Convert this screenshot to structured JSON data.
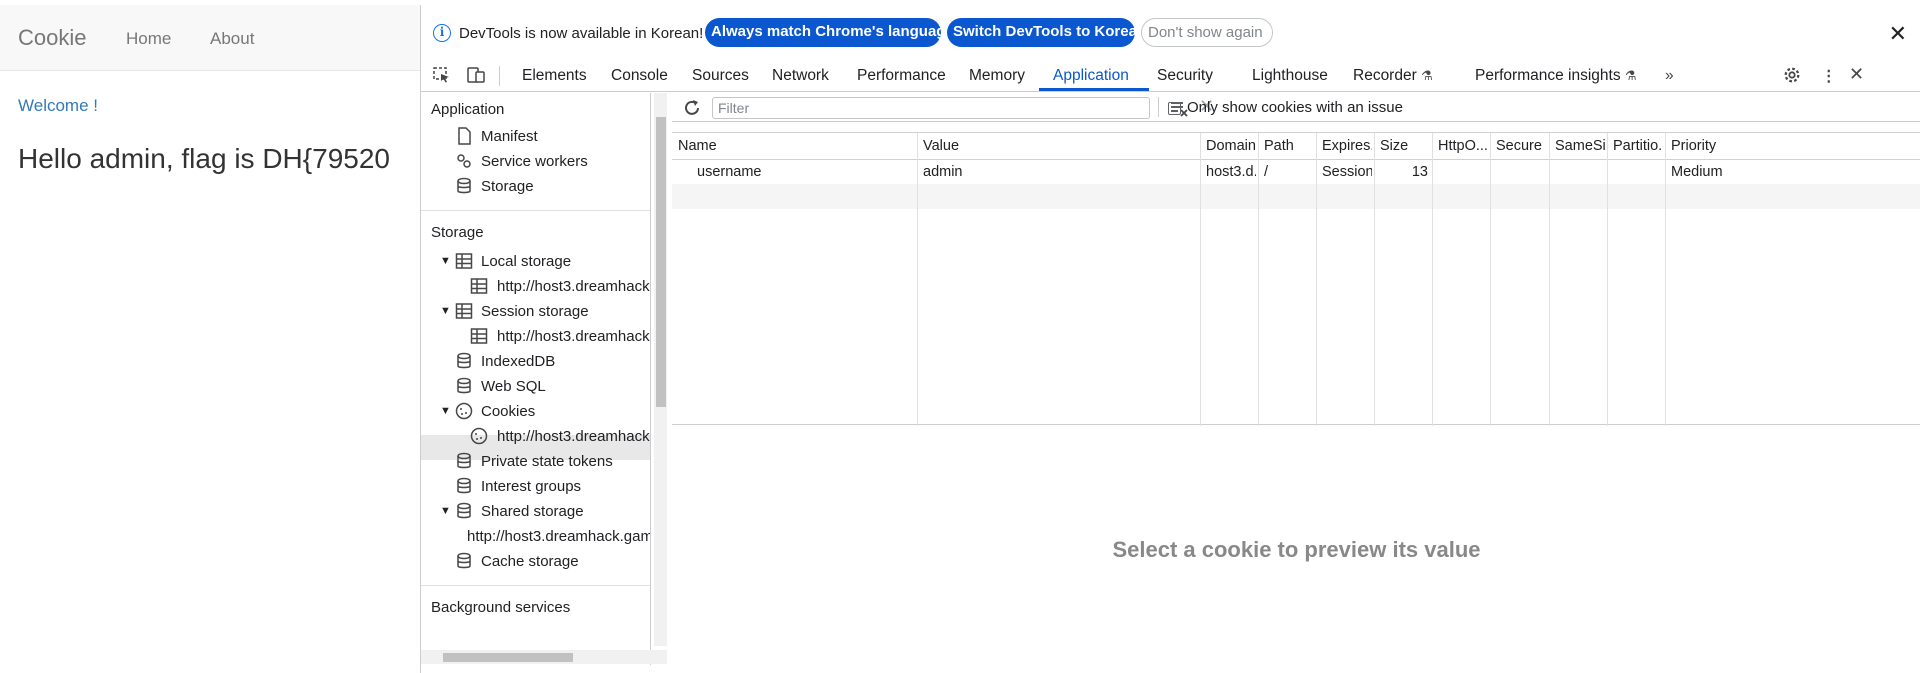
{
  "webpage": {
    "brand": "Cookie",
    "nav": [
      "Home",
      "About"
    ],
    "welcome": "Welcome !",
    "message": "Hello admin, flag is DH{79520"
  },
  "infobar": {
    "text": "DevTools is now available in Korean!",
    "btn_match": "Always match Chrome's language",
    "btn_switch": "Switch DevTools to Korean",
    "btn_dont_show": "Don't show again"
  },
  "tabs": [
    "Elements",
    "Console",
    "Sources",
    "Network",
    "Performance",
    "Memory",
    "Application",
    "Security",
    "Lighthouse",
    "Recorder",
    "Performance insights"
  ],
  "active_tab": "Application",
  "sidebar": {
    "application_heading": "Application",
    "application_items": [
      "Manifest",
      "Service workers",
      "Storage"
    ],
    "storage_heading": "Storage",
    "local_storage": "Local storage",
    "local_storage_child": "http://host3.dreamhack",
    "session_storage": "Session storage",
    "session_storage_child": "http://host3.dreamhack",
    "indexeddb": "IndexedDB",
    "websql": "Web SQL",
    "cookies": "Cookies",
    "cookies_child": "http://host3.dreamhack",
    "private_state_tokens": "Private state tokens",
    "interest_groups": "Interest groups",
    "shared_storage": "Shared storage",
    "shared_storage_child": "http://host3.dreamhack.gam",
    "cache_storage": "Cache storage",
    "background_heading": "Background services"
  },
  "toolbar": {
    "filter_placeholder": "Filter",
    "only_issue_label": "Only show cookies with an issue"
  },
  "table": {
    "headers": [
      "Name",
      "Value",
      "Domain",
      "Path",
      "Expires...",
      "Size",
      "HttpO...",
      "Secure",
      "SameSi...",
      "Partitio...",
      "Priority"
    ],
    "rows": [
      [
        "username",
        "admin",
        "host3.d...",
        "/",
        "Session",
        "13",
        "",
        "",
        "",
        "",
        "Medium"
      ]
    ]
  },
  "preview_message": "Select a cookie to preview its value",
  "colors": {
    "accent": "#0b57d0",
    "link": "#337ab7"
  }
}
